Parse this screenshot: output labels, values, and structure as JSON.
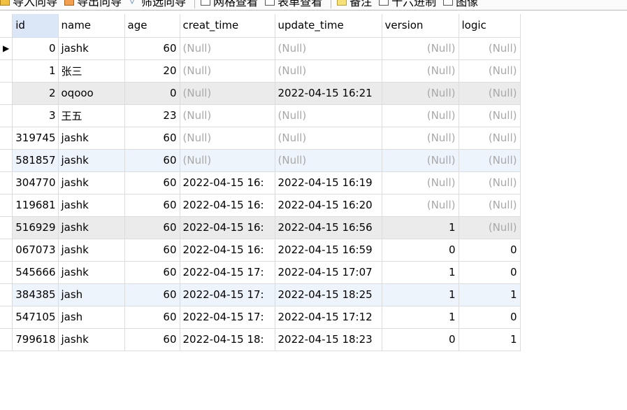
{
  "toolbar": {
    "items": [
      {
        "label": "导入向导",
        "icon": "import-icon"
      },
      {
        "label": "导出向导",
        "icon": "export-icon"
      },
      {
        "label": "筛选向导",
        "icon": "filter-icon"
      },
      {
        "label": "网格查看",
        "icon": "grid-view-icon"
      },
      {
        "label": "表单查看",
        "icon": "form-view-icon"
      },
      {
        "label": "备注",
        "icon": "note-icon"
      },
      {
        "label": "十六进制",
        "icon": "hex-icon"
      },
      {
        "label": "图像",
        "icon": "image-icon"
      }
    ]
  },
  "grid": {
    "columns": [
      "id",
      "name",
      "age",
      "creat_time",
      "update_time",
      "version",
      "logic"
    ],
    "null_text": "(Null)",
    "row_marker": "▶",
    "rows": [
      {
        "id": "0",
        "name": "jashk",
        "age": "60",
        "creat_time": "(Null)",
        "update_time": "(Null)",
        "version": "(Null)",
        "logic": "(Null)",
        "style": "current"
      },
      {
        "id": "1",
        "name": "张三",
        "age": "20",
        "creat_time": "(Null)",
        "update_time": "(Null)",
        "version": "(Null)",
        "logic": "(Null)",
        "style": ""
      },
      {
        "id": "2",
        "name": "oqooo",
        "age": "0",
        "creat_time": "(Null)",
        "update_time": "2022-04-15 16:21",
        "version": "(Null)",
        "logic": "(Null)",
        "style": "gray"
      },
      {
        "id": "3",
        "name": "王五",
        "age": "23",
        "creat_time": "(Null)",
        "update_time": "(Null)",
        "version": "(Null)",
        "logic": "(Null)",
        "style": ""
      },
      {
        "id": "319745",
        "name": "jashk",
        "age": "60",
        "creat_time": "(Null)",
        "update_time": "(Null)",
        "version": "(Null)",
        "logic": "(Null)",
        "style": ""
      },
      {
        "id": "581857",
        "name": "jashk",
        "age": "60",
        "creat_time": "(Null)",
        "update_time": "(Null)",
        "version": "(Null)",
        "logic": "(Null)",
        "style": "blue"
      },
      {
        "id": "304770",
        "name": "jashk",
        "age": "60",
        "creat_time": "2022-04-15 16:",
        "update_time": "2022-04-15 16:19",
        "version": "(Null)",
        "logic": "(Null)",
        "style": ""
      },
      {
        "id": "119681",
        "name": "jashk",
        "age": "60",
        "creat_time": "2022-04-15 16:",
        "update_time": "2022-04-15 16:20",
        "version": "(Null)",
        "logic": "(Null)",
        "style": ""
      },
      {
        "id": "516929",
        "name": "jashk",
        "age": "60",
        "creat_time": "2022-04-15 16:",
        "update_time": "2022-04-15 16:56",
        "version": "1",
        "logic": "(Null)",
        "style": "gray"
      },
      {
        "id": "067073",
        "name": "jashk",
        "age": "60",
        "creat_time": "2022-04-15 16:",
        "update_time": "2022-04-15 16:59",
        "version": "0",
        "logic": "0",
        "style": ""
      },
      {
        "id": "545666",
        "name": "jashk",
        "age": "60",
        "creat_time": "2022-04-15 17:",
        "update_time": "2022-04-15 17:07",
        "version": "1",
        "logic": "0",
        "style": ""
      },
      {
        "id": "384385",
        "name": "jash",
        "age": "60",
        "creat_time": "2022-04-15 17:",
        "update_time": "2022-04-15 18:25",
        "version": "1",
        "logic": "1",
        "style": "blue"
      },
      {
        "id": "547105",
        "name": "jash",
        "age": "60",
        "creat_time": "2022-04-15 17:",
        "update_time": "2022-04-15 17:12",
        "version": "1",
        "logic": "0",
        "style": ""
      },
      {
        "id": "799618",
        "name": "jashk",
        "age": "60",
        "creat_time": "2022-04-15 18:",
        "update_time": "2022-04-15 18:23",
        "version": "0",
        "logic": "1",
        "style": ""
      }
    ]
  },
  "colors": {
    "header_selected": "#dbe6f6",
    "null_text": "#a8a8a8",
    "row_gray": "#ebebeb",
    "row_blue": "#eef4fb"
  }
}
